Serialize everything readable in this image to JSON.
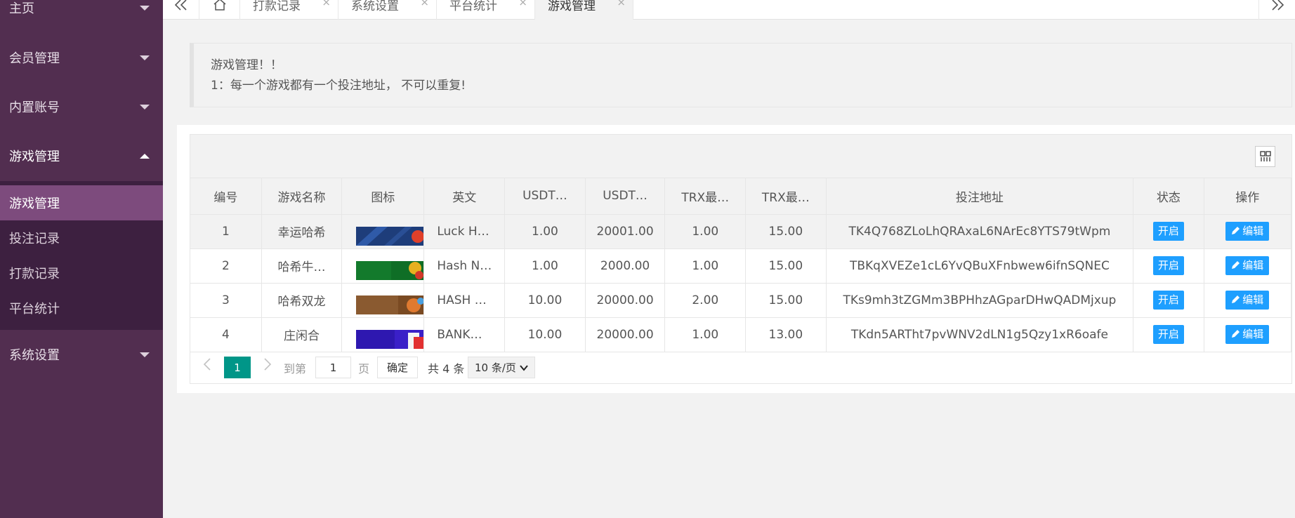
{
  "sidebar": {
    "menu": [
      {
        "label": "主页"
      },
      {
        "label": "会员管理"
      },
      {
        "label": "内置账号"
      },
      {
        "label": "游戏管理"
      },
      {
        "label": "系统设置"
      }
    ],
    "submenu": [
      {
        "label": "游戏管理"
      },
      {
        "label": "投注记录"
      },
      {
        "label": "打款记录"
      },
      {
        "label": "平台统计"
      }
    ]
  },
  "tabs": [
    {
      "label": "打款记录"
    },
    {
      "label": "系统设置"
    },
    {
      "label": "平台统计"
    },
    {
      "label": "游戏管理"
    }
  ],
  "tab_close": "×",
  "notice": {
    "line1": "游戏管理！！",
    "line2": "1：每一个游戏都有一个投注地址， 不可以重复!"
  },
  "table": {
    "columns": [
      "编号",
      "游戏名称",
      "图标",
      "英文",
      "USDT…",
      "USDT…",
      "TRX最…",
      "TRX最…",
      "投注地址",
      "状态",
      "操作"
    ],
    "rows": [
      {
        "id": "1",
        "name": "幸运哈希",
        "en": "Luck H…",
        "usdt_min": "1.00",
        "usdt_max": "20001.00",
        "trx_min": "1.00",
        "trx_max": "15.00",
        "address": "TK4Q768ZLoLhQRAxaL6NArEc8YTS79tWpm",
        "status": "开启",
        "action": "编辑"
      },
      {
        "id": "2",
        "name": "哈希牛…",
        "en": "Hash N…",
        "usdt_min": "1.00",
        "usdt_max": "2000.00",
        "trx_min": "1.00",
        "trx_max": "15.00",
        "address": "TBKqXVEZe1cL6YvQBuXFnbwew6ifnSQNEC",
        "status": "开启",
        "action": "编辑"
      },
      {
        "id": "3",
        "name": "哈希双龙",
        "en": "HASH …",
        "usdt_min": "10.00",
        "usdt_max": "20000.00",
        "trx_min": "2.00",
        "trx_max": "15.00",
        "address": "TKs9mh3tZGMm3BPHhzAGparDHwQADMjxup",
        "status": "开启",
        "action": "编辑"
      },
      {
        "id": "4",
        "name": "庄闲合",
        "en": "BANK…",
        "usdt_min": "10.00",
        "usdt_max": "20000.00",
        "trx_min": "1.00",
        "trx_max": "13.00",
        "address": "TKdn5ARTht7pvWNV2dLN1g5Qzy1xR6oafe",
        "status": "开启",
        "action": "编辑"
      }
    ]
  },
  "pager": {
    "current": "1",
    "goto_label": "到第",
    "page_input": "1",
    "page_unit": "页",
    "confirm": "确定",
    "total": "共 4 条",
    "page_size": "10 条/页"
  },
  "colors": {
    "sidebar": "#522e50",
    "submenu": "#3d2040",
    "submenu_selected": "#7d4b7d",
    "primary_button": "#1e9fff",
    "pager_active": "#009688"
  }
}
